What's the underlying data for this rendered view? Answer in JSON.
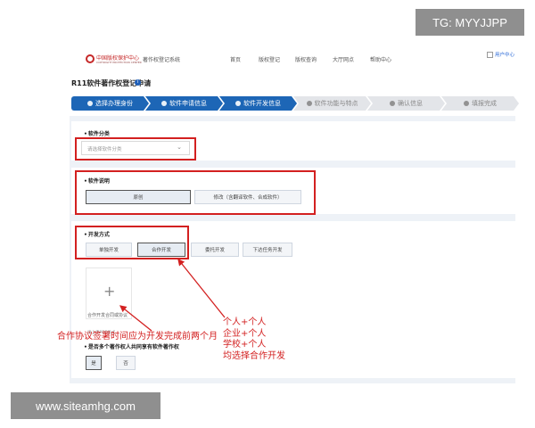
{
  "header": {
    "logo_text": "中国版权保护中心",
    "logo_sub": "COPYRIGHT PROTECTION CENTER",
    "system_name": "著作权登记系统",
    "nav": [
      "首页",
      "版权登记",
      "版权查询",
      "大厅网点",
      "帮助中心"
    ],
    "user_label": "用户中心"
  },
  "page": {
    "title": "R11软件著作权登记申请",
    "info_icon": "info-icon"
  },
  "steps": [
    {
      "label": "选择办理身份",
      "state": "active"
    },
    {
      "label": "软件申请信息",
      "state": "active"
    },
    {
      "label": "软件开发信息",
      "state": "active"
    },
    {
      "label": "软件功能与特点",
      "state": "inactive"
    },
    {
      "label": "确认信息",
      "state": "inactive"
    },
    {
      "label": "填报完成",
      "state": "inactive"
    }
  ],
  "software_category": {
    "label": "软件分类",
    "placeholder": "请选择软件分类"
  },
  "software_desc": {
    "label": "软件说明",
    "options": [
      "原创",
      "修改（含翻译软件、合成软件）"
    ],
    "selected": "原创"
  },
  "dev_method": {
    "label": "开发方式",
    "options": [
      "单独开发",
      "合作开发",
      "委托开发",
      "下达任务开发"
    ],
    "selected": "合作开发"
  },
  "upload": {
    "label": "合作开发合同或协议",
    "hint": "请上传PDF格式"
  },
  "co_owner": {
    "label": "是否多个著作权人共同享有软件著作权",
    "options": [
      "是",
      "否"
    ],
    "selected": "是"
  },
  "annotations": {
    "note_left": "合作协议签署时间应为开发完成前两个月",
    "note_right": [
      "个人+个人",
      "企业+个人",
      "学校+个人",
      "均选择合作开发"
    ]
  },
  "watermarks": {
    "top_right": "TG: MYYJJPP",
    "bottom_left": "www.siteamhg.com"
  },
  "colors": {
    "active_step": "#1d66b6",
    "annotation_red": "#d32020"
  }
}
